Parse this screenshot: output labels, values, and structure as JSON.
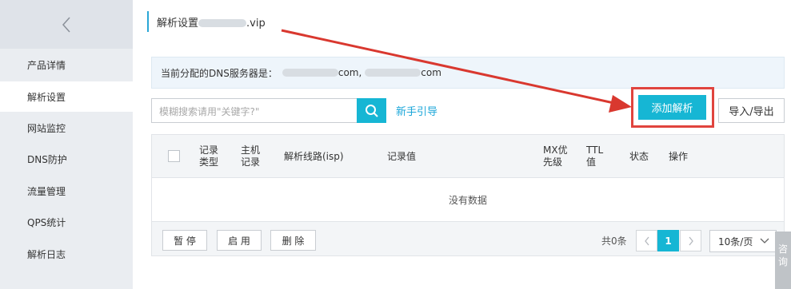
{
  "sidebar": {
    "items": [
      {
        "label": "产品详情"
      },
      {
        "label": "解析设置"
      },
      {
        "label": "网站监控"
      },
      {
        "label": "DNS防护"
      },
      {
        "label": "流量管理"
      },
      {
        "label": "QPS统计"
      },
      {
        "label": "解析日志"
      }
    ],
    "active_index": 1
  },
  "header": {
    "title_prefix": "解析设置",
    "title_suffix": ".vip"
  },
  "dns_info": {
    "label": "当前分配的DNS服务器是：",
    "server1_suffix": "com,",
    "server2_suffix": "com"
  },
  "search": {
    "placeholder": "模糊搜索请用\"关键字?\""
  },
  "guide_link": "新手引导",
  "add_button": "添加解析",
  "import_export_button": "导入/导出",
  "table": {
    "headers": {
      "record_type": [
        "记录",
        "类型"
      ],
      "host": [
        "主机",
        "记录"
      ],
      "line": "解析线路(isp)",
      "value": "记录值",
      "mx": [
        "MX优",
        "先级"
      ],
      "ttl": [
        "TTL",
        "值"
      ],
      "status": "状态",
      "action": "操作"
    },
    "empty_text": "没有数据",
    "footer_buttons": [
      "暂 停",
      "启 用",
      "删 除"
    ],
    "total": "共0条",
    "current_page": "1",
    "page_size": "10条/页"
  },
  "consult_tab": [
    "咨",
    "询"
  ],
  "colors": {
    "accent": "#16b6d4",
    "highlight": "#e0443e",
    "link": "#1aa6d9"
  }
}
